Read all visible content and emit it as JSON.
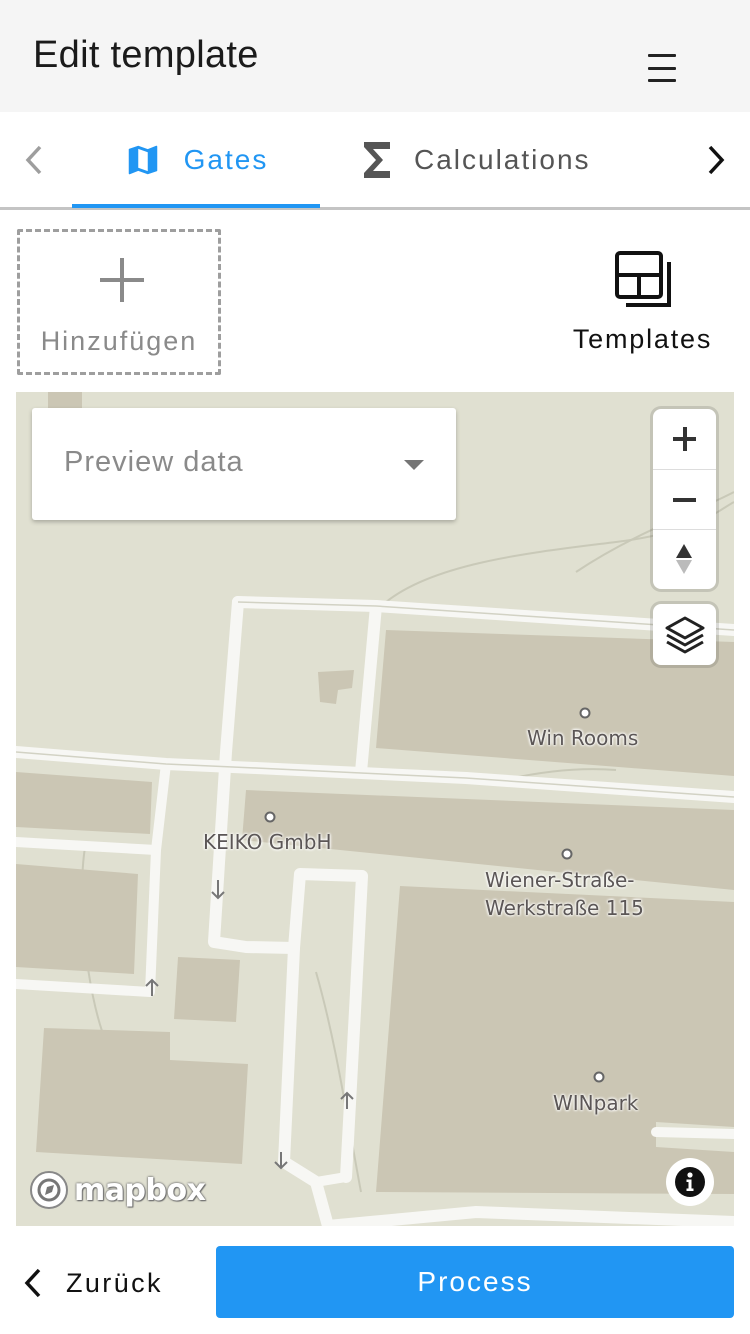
{
  "header": {
    "title": "Edit template",
    "menu_icon": "hamburger-menu-icon"
  },
  "tabs": {
    "prev_icon": "chevron-left-icon",
    "next_icon": "chevron-right-icon",
    "items": [
      {
        "label": "Gates",
        "icon": "map-icon",
        "active": true
      },
      {
        "label": "Calculations",
        "icon": "sigma-icon",
        "active": false
      }
    ]
  },
  "actions": {
    "add_label": "Hinzufügen",
    "templates_label": "Templates"
  },
  "map": {
    "preview_placeholder": "Preview data",
    "pois": [
      {
        "label": "Win Rooms"
      },
      {
        "label": "KEIKO GmbH"
      },
      {
        "label": "Wiener-Straße-"
      },
      {
        "label": "Werkstraße 115"
      },
      {
        "label": "WINpark"
      }
    ],
    "attribution": "mapbox"
  },
  "footer": {
    "back_label": "Zurück",
    "process_label": "Process"
  },
  "colors": {
    "accent": "#2196f3",
    "map_background": "#e0e0d1",
    "building": "#cbc6b4",
    "road": "#f7f7f4"
  }
}
